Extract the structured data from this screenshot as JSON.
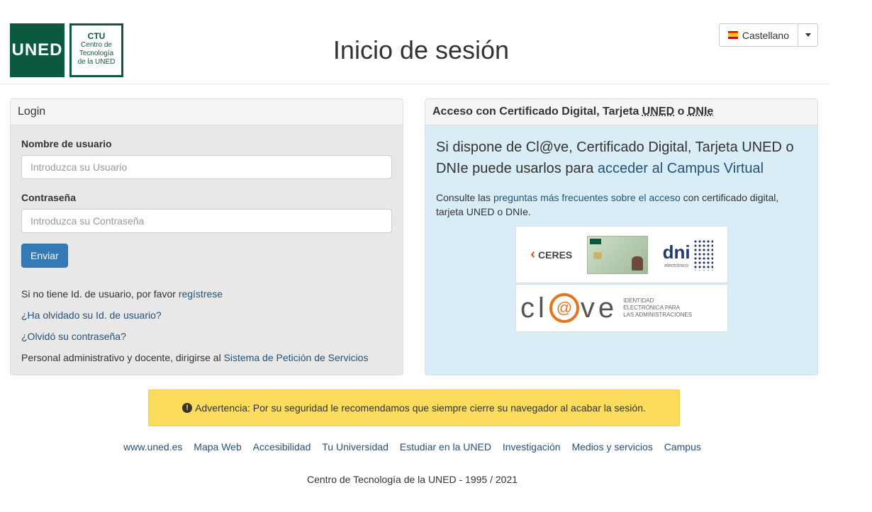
{
  "header": {
    "logo_main": "UNED",
    "logo_ctu": {
      "title": "CTU",
      "line1": "Centro de",
      "line2": "Tecnología",
      "line3": "de la UNED"
    },
    "title": "Inicio de sesión",
    "language": "Castellano"
  },
  "login": {
    "heading": "Login",
    "username_label": "Nombre de usuario",
    "username_placeholder": "Introduzca su Usuario",
    "password_label": "Contraseña",
    "password_placeholder": "Introduzca su Contraseña",
    "submit_label": "Enviar",
    "register_text": "Si no tiene Id. de usuario, por favor",
    "register_link": "regístrese",
    "forgot_user": "¿Ha olvidado su Id. de usuario?",
    "forgot_password": "¿Olvidó su contraseña?",
    "staff_text": "Personal administrativo y docente, dirigirse al",
    "staff_link": "Sistema de Petición de Servicios"
  },
  "certificate": {
    "heading_prefix": "Acceso con Certificado Digital, Tarjeta",
    "heading_uned": "UNED",
    "heading_o": "o",
    "heading_dnie": "DNIe",
    "lead_text": "Si dispone de Cl@ve, Certificado Digital, Tarjeta UNED o DNIe puede usarlos para",
    "lead_link": "acceder al Campus Virtual",
    "consult_prefix": "Consulte las",
    "consult_link": "preguntas más frecuentes sobre el acceso",
    "consult_suffix": "con certificado digital, tarjeta UNED o DNIe.",
    "logos": {
      "ceres": "CERES",
      "card": "UNED",
      "dni": "dni",
      "dni_sub": "electrónico",
      "clave_left": "cl",
      "clave_at": "@",
      "clave_right": "ve",
      "clave_sub1": "IDENTIDAD",
      "clave_sub2": "ELECTRÓNICA PARA",
      "clave_sub3": "LAS ADMINISTRACIONES"
    }
  },
  "warning": {
    "icon": "!",
    "text": "Advertencia: Por su seguridad le recomendamos que siempre cierre su navegador al acabar la sesión."
  },
  "footer": {
    "links": [
      "www.uned.es",
      "Mapa Web",
      "Accesibilidad",
      "Tu Universidad",
      "Estudiar en la UNED",
      "Investigación",
      "Medios y servicios",
      "Campus"
    ],
    "copyright": "Centro de Tecnología de la UNED - 1995 / 2021"
  },
  "colors": {
    "uned_green": "#0b5a3d",
    "link": "#23527c",
    "primary": "#337ab7",
    "warning_bg": "#fbdc5d",
    "info_bg": "#d9edf7"
  }
}
